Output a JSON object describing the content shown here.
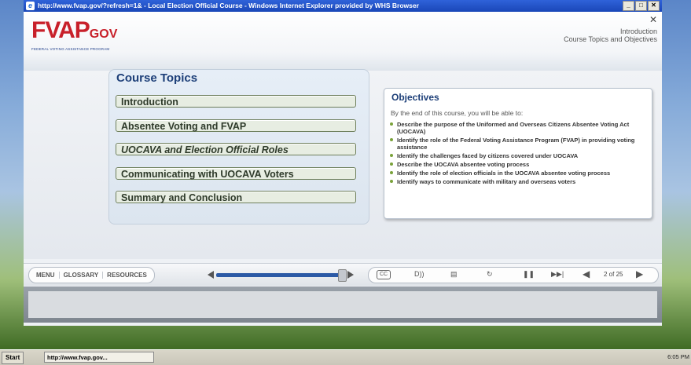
{
  "window": {
    "title": "http://www.fvap.gov/?refresh=1& - Local Election Official Course - Windows Internet Explorer provided by WHS Browser"
  },
  "header": {
    "logo_main": "FVAP",
    "logo_gov": "GOV",
    "logo_sub": "FEDERAL VOTING ASSISTANCE PROGRAM",
    "section_title": "Introduction",
    "section_subtitle": "Course Topics and Objectives"
  },
  "topics": {
    "heading": "Course Topics",
    "items": [
      "Introduction",
      "Absentee Voting and FVAP",
      "UOCAVA and Election Official Roles",
      "Communicating with UOCAVA Voters",
      "Summary and Conclusion"
    ]
  },
  "objectives": {
    "heading": "Objectives",
    "intro": "By the end of this course, you will be able to:",
    "items": [
      "Describe the purpose of the Uniformed and Overseas Citizens Absentee Voting Act (UOCAVA)",
      "Identify the role of the Federal Voting Assistance Program (FVAP) in providing voting assistance",
      "Identify the challenges faced by citizens covered under UOCAVA",
      "Describe the UOCAVA absentee voting process",
      "Identify the role of election officials in the UOCAVA absentee voting process",
      "Identify ways to communicate with military and overseas voters"
    ]
  },
  "controls": {
    "menu": "MENU",
    "glossary": "GLOSSARY",
    "resources": "RESOURCES",
    "cc": "CC",
    "audio": "D))",
    "transcript": "▤",
    "replay": "↻",
    "pause": "❚❚",
    "next_skip": "▶▶|",
    "page_indicator": "2 of 25",
    "progress_fraction": 0.08
  },
  "taskbar": {
    "start": "Start",
    "task": "http://www.fvap.gov...",
    "clock": "6:05 PM"
  }
}
